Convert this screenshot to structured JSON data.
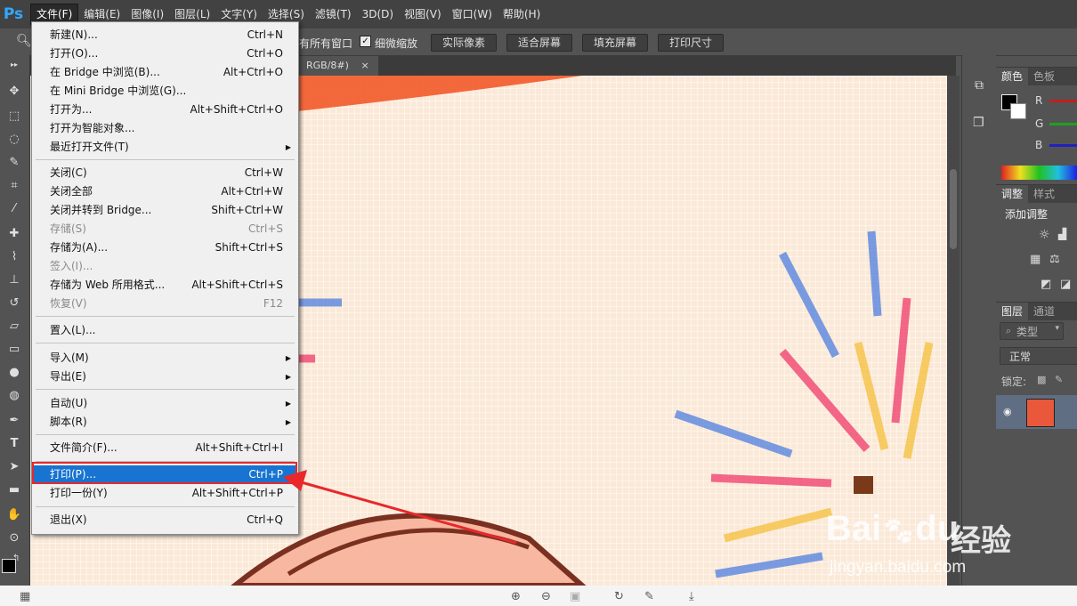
{
  "app": {
    "logo": "Ps"
  },
  "menubar": {
    "items": [
      {
        "label": "文件(F)",
        "active": true
      },
      {
        "label": "编辑(E)"
      },
      {
        "label": "图像(I)"
      },
      {
        "label": "图层(L)"
      },
      {
        "label": "文字(Y)"
      },
      {
        "label": "选择(S)"
      },
      {
        "label": "滤镜(T)"
      },
      {
        "label": "3D(D)"
      },
      {
        "label": "视图(V)"
      },
      {
        "label": "窗口(W)"
      },
      {
        "label": "帮助(H)"
      }
    ]
  },
  "options": {
    "all_windows": "有所有窗口",
    "fine_zoom": "细微缩放",
    "buttons": [
      "实际像素",
      "适合屏幕",
      "填充屏幕",
      "打印尺寸"
    ]
  },
  "document": {
    "tab_title": "RGB/8#)",
    "close_glyph": "×"
  },
  "file_menu": {
    "items": [
      {
        "label": "新建(N)...",
        "shortcut": "Ctrl+N"
      },
      {
        "label": "打开(O)...",
        "shortcut": "Ctrl+O"
      },
      {
        "label": "在 Bridge 中浏览(B)...",
        "shortcut": "Alt+Ctrl+O"
      },
      {
        "label": "在 Mini Bridge 中浏览(G)...",
        "shortcut": ""
      },
      {
        "label": "打开为...",
        "shortcut": "Alt+Shift+Ctrl+O"
      },
      {
        "label": "打开为智能对象...",
        "shortcut": ""
      },
      {
        "label": "最近打开文件(T)",
        "shortcut": "",
        "submenu": true
      },
      {
        "label": "关闭(C)",
        "shortcut": "Ctrl+W"
      },
      {
        "label": "关闭全部",
        "shortcut": "Alt+Ctrl+W"
      },
      {
        "label": "关闭并转到 Bridge...",
        "shortcut": "Shift+Ctrl+W"
      },
      {
        "label": "存储(S)",
        "shortcut": "Ctrl+S",
        "disabled": true
      },
      {
        "label": "存储为(A)...",
        "shortcut": "Shift+Ctrl+S"
      },
      {
        "label": "签入(I)...",
        "shortcut": "",
        "disabled": true
      },
      {
        "label": "存储为 Web 所用格式...",
        "shortcut": "Alt+Shift+Ctrl+S"
      },
      {
        "label": "恢复(V)",
        "shortcut": "F12",
        "disabled": true
      },
      {
        "label": "置入(L)...",
        "shortcut": ""
      },
      {
        "label": "导入(M)",
        "shortcut": "",
        "submenu": true
      },
      {
        "label": "导出(E)",
        "shortcut": "",
        "submenu": true
      },
      {
        "label": "自动(U)",
        "shortcut": "",
        "submenu": true
      },
      {
        "label": "脚本(R)",
        "shortcut": "",
        "submenu": true
      },
      {
        "label": "文件简介(F)...",
        "shortcut": "Alt+Shift+Ctrl+I"
      },
      {
        "label": "打印(P)...",
        "shortcut": "Ctrl+P",
        "highlighted": true
      },
      {
        "label": "打印一份(Y)",
        "shortcut": "Alt+Shift+Ctrl+P"
      },
      {
        "label": "退出(X)",
        "shortcut": "Ctrl+Q"
      }
    ]
  },
  "panels": {
    "color": {
      "tabs": [
        "颜色",
        "色板"
      ],
      "channels": [
        "R",
        "G",
        "B"
      ]
    },
    "adjust": {
      "tabs": [
        "调整",
        "样式"
      ],
      "title": "添加调整"
    },
    "layers": {
      "tabs": [
        "图层",
        "通道"
      ],
      "filter": "类型",
      "blend_mode": "正常",
      "lock_label": "锁定:"
    }
  },
  "watermark": {
    "brand": "Bai",
    "brand2": "du",
    "brand_cn": "经验",
    "url": "jingyan.baidu.com"
  },
  "colors": {
    "highlight": "#1874d0",
    "annotation": "#e8282b",
    "brand_blue": "#31a8ff"
  }
}
